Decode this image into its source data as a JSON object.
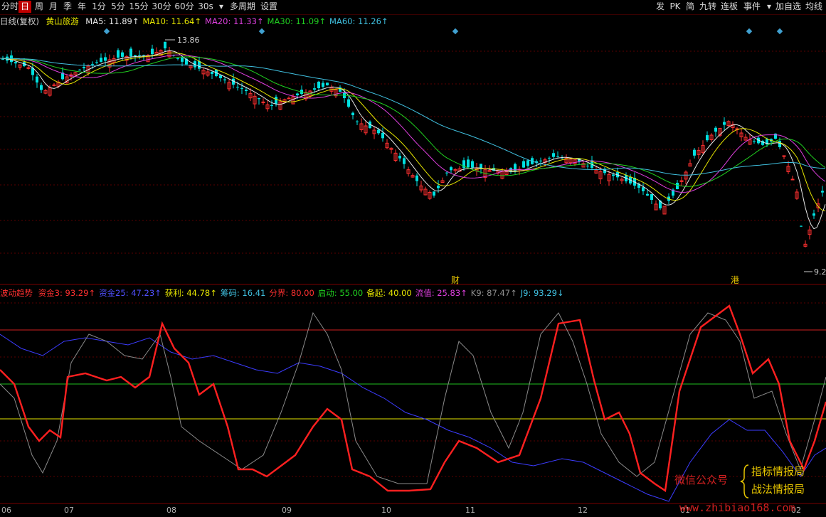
{
  "toolbar": {
    "left": [
      "分时",
      "日",
      "周",
      "月",
      "季",
      "年",
      "1分",
      "5分",
      "15分",
      "30分",
      "60分",
      "30s",
      "▾",
      "多周期",
      "设置"
    ],
    "active": "日",
    "right": [
      "发",
      "PK",
      "简",
      "九转",
      "连板",
      "事件",
      "▾",
      "加自选",
      "均线"
    ]
  },
  "price_legend": {
    "period": "日线(复权)",
    "name": "黄山旅游",
    "items": [
      {
        "label": "MA5: 11.89↑",
        "color": "#e8e8e8"
      },
      {
        "label": "MA10: 11.64↑",
        "color": "#e6e600"
      },
      {
        "label": "MA20: 11.33↑",
        "color": "#e040e0"
      },
      {
        "label": "MA30: 11.09↑",
        "color": "#20d020"
      },
      {
        "label": "MA60: 11.26↑",
        "color": "#40c0e0"
      }
    ],
    "high_label": "13.86",
    "low_label": "9.2",
    "event_marks": [
      "财",
      "港"
    ]
  },
  "indicator_legend": {
    "name": "波动趋势",
    "items": [
      {
        "label": "资金3: 93.29↑",
        "color": "#ff3030"
      },
      {
        "label": "资金25: 47.23↑",
        "color": "#5050ff"
      },
      {
        "label": "获利: 44.78↑",
        "color": "#e6e600"
      },
      {
        "label": "筹码: 16.41",
        "color": "#40c0e0"
      },
      {
        "label": "分界: 80.00",
        "color": "#ff3030"
      },
      {
        "label": "启动: 55.00",
        "color": "#20d020"
      },
      {
        "label": "备起: 40.00",
        "color": "#e6e600"
      },
      {
        "label": "流值: 25.83↑",
        "color": "#e040e0"
      },
      {
        "label": "K9: 87.47↑",
        "color": "#909090"
      },
      {
        "label": "J9: 93.29↓",
        "color": "#40c0e0"
      }
    ]
  },
  "x_axis": [
    "06",
    "07",
    "08",
    "09",
    "10",
    "11",
    "12",
    "01",
    "02"
  ],
  "watermark": {
    "wechat": "微信公众号",
    "brand1": "指标情报局",
    "brand2": "战法情报局",
    "url": "www.zhibiao168.com"
  },
  "colors": {
    "up": "#ff3030",
    "down": "#00e0e0",
    "grid": "#5a0000"
  }
}
